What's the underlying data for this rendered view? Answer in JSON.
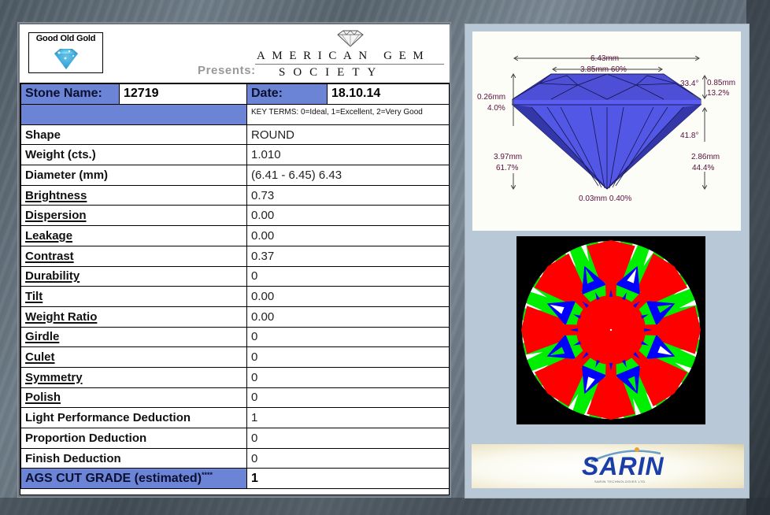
{
  "header": {
    "retailer_logo_text": "Good Old Gold",
    "presents_label": "Presents:",
    "ags_logo_line1": "AMERICAN GEM",
    "ags_logo_line2": "SOCIETY"
  },
  "report": {
    "stone_name_label": "Stone Name:",
    "stone_name_value": "12719",
    "date_label": "Date:",
    "date_value": "18.10.14",
    "key_terms": "KEY TERMS: 0=Ideal, 1=Excellent, 2=Very Good",
    "rows": [
      {
        "label": "Shape",
        "value": "ROUND",
        "underline": false
      },
      {
        "label": "Weight (cts.)",
        "value": "1.010",
        "underline": false
      },
      {
        "label": "Diameter (mm)",
        "value": "(6.41 - 6.45) 6.43",
        "underline": false
      },
      {
        "label": "Brightness",
        "value": "0.73",
        "underline": true
      },
      {
        "label": "Dispersion",
        "value": "0.00",
        "underline": true
      },
      {
        "label": "Leakage",
        "value": "0.00",
        "underline": true
      },
      {
        "label": "Contrast",
        "value": "0.37",
        "underline": true
      },
      {
        "label": "Durability",
        "value": "0",
        "underline": true
      },
      {
        "label": "Tilt",
        "value": "0.00",
        "underline": true
      },
      {
        "label": "Weight Ratio",
        "value": "0.00",
        "underline": true
      },
      {
        "label": "Girdle",
        "value": "0",
        "underline": true
      },
      {
        "label": "Culet",
        "value": "0",
        "underline": true
      },
      {
        "label": "Symmetry",
        "value": "0",
        "underline": true
      },
      {
        "label": "Polish",
        "value": "0",
        "underline": true
      },
      {
        "label": "Light Performance Deduction",
        "value": "1",
        "underline": false
      },
      {
        "label": "Proportion Deduction",
        "value": "0",
        "underline": false
      },
      {
        "label": "Finish Deduction",
        "value": "0",
        "underline": false
      }
    ],
    "grade_label": "AGS CUT GRADE (estimated)",
    "grade_suffix": "****",
    "grade_value": "1"
  },
  "profile_diagram": {
    "diameter": "6.43mm",
    "table": "3.85mm 60%",
    "crown_angle": "33.4°",
    "crown_height_mm": "0.85mm",
    "crown_height_pct": "13.2%",
    "girdle_mm": "0.26mm",
    "girdle_pct": "4.0%",
    "pavilion_angle": "41.8°",
    "total_depth_mm": "3.97mm",
    "total_depth_pct": "61.7%",
    "pavilion_depth_mm": "2.86mm",
    "pavilion_depth_pct": "44.4%",
    "culet": "0.03mm 0.40%"
  },
  "aset_image": {
    "colors": {
      "red": "#ff0000",
      "green": "#00ee00",
      "blue": "#0000ff",
      "white": "#ffffff",
      "background": "#000000"
    }
  },
  "footer": {
    "sarin_logo_text": "SARIN",
    "sarin_tagline": "SARIN TECHNOLOGIES LTD."
  },
  "colors": {
    "header_cell_blue": "#6c84d6",
    "gem_blue": "#4a4fd8",
    "annotation_text": "#5a0e3e"
  }
}
